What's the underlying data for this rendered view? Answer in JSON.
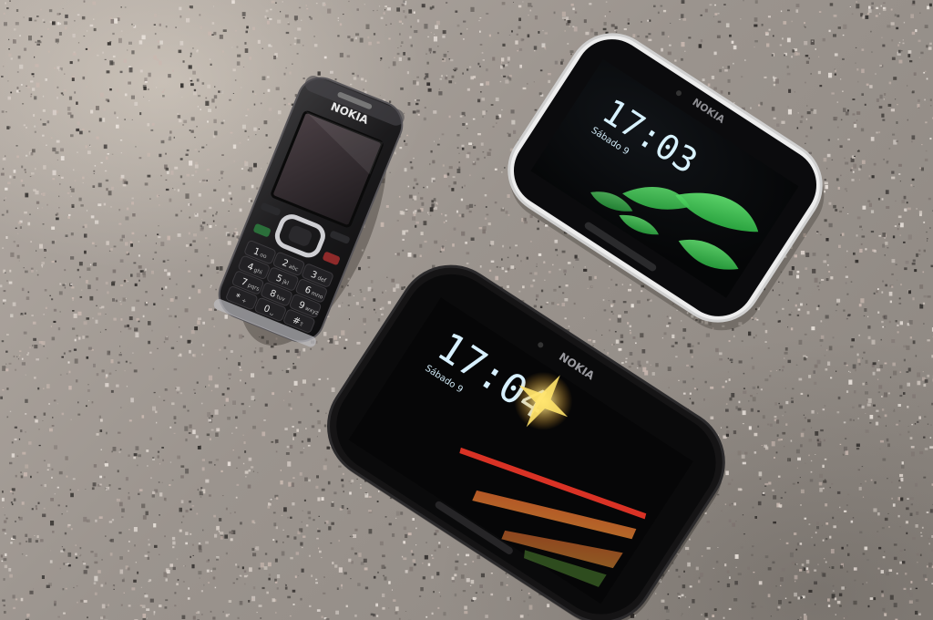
{
  "photo": {
    "surface": "granite countertop",
    "phones": [
      {
        "id": "candybar",
        "brand": "NOKIA",
        "color": "#1c1b1c",
        "keypad": [
          {
            "digit": "1",
            "letters": "oo"
          },
          {
            "digit": "2",
            "letters": "abc"
          },
          {
            "digit": "3",
            "letters": "def"
          },
          {
            "digit": "4",
            "letters": "ghi"
          },
          {
            "digit": "5",
            "letters": "jkl"
          },
          {
            "digit": "6",
            "letters": "mno"
          },
          {
            "digit": "7",
            "letters": "pqrs"
          },
          {
            "digit": "8",
            "letters": "tuv"
          },
          {
            "digit": "9",
            "letters": "wxyz"
          },
          {
            "digit": "*",
            "letters": "+"
          },
          {
            "digit": "0",
            "letters": "␣"
          },
          {
            "digit": "#",
            "letters": "⇧"
          }
        ]
      },
      {
        "id": "white-smartphone",
        "brand": "NOKIA",
        "time": "17:03",
        "date": "Sábado 9",
        "color": "#f4f4f4",
        "accent": "#27c744"
      },
      {
        "id": "black-smartphone",
        "brand": "NOKIA",
        "time": "17:04",
        "date": "Sábado 9",
        "color": "#121112",
        "accent": "#e23a2c"
      }
    ]
  }
}
